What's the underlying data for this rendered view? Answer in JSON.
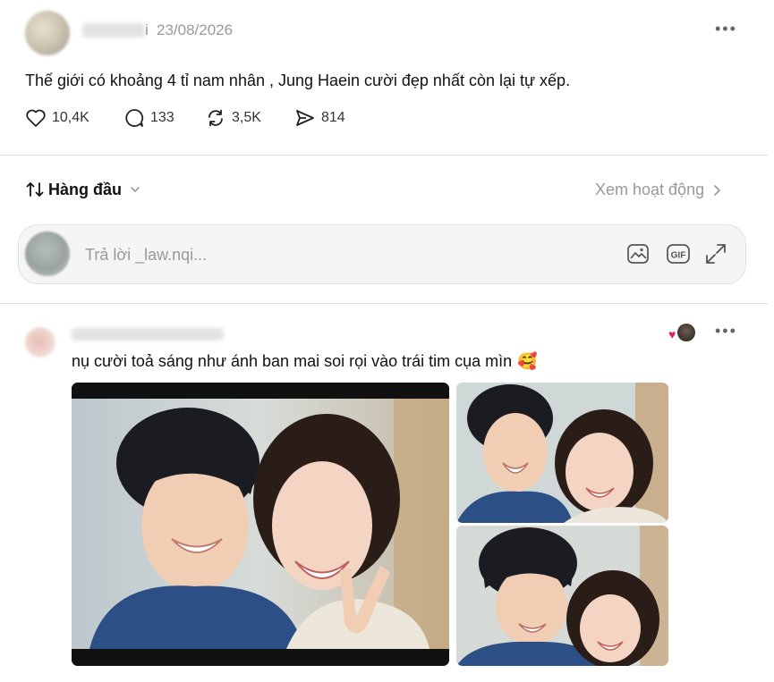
{
  "post": {
    "date": "23/08/2026",
    "text": "Thế giới có khoảng 4 tỉ nam nhân , Jung Haein cười đẹp nhất còn lại tự xếp.",
    "likes": "10,4K",
    "comments": "133",
    "reposts": "3,5K",
    "shares": "814"
  },
  "sort": {
    "label": "Hàng đầu",
    "activity": "Xem hoạt động"
  },
  "reply": {
    "placeholder": "Trả lời _law.nqi..."
  },
  "reply_post": {
    "text": "nụ cười toả sáng như ánh ban mai soi rọi vào trái tim cụa mìn",
    "emoji": "🥰"
  },
  "colors": {
    "divider": "#dedede",
    "muted": "#9a9a9a",
    "heart": "#e0245e"
  }
}
